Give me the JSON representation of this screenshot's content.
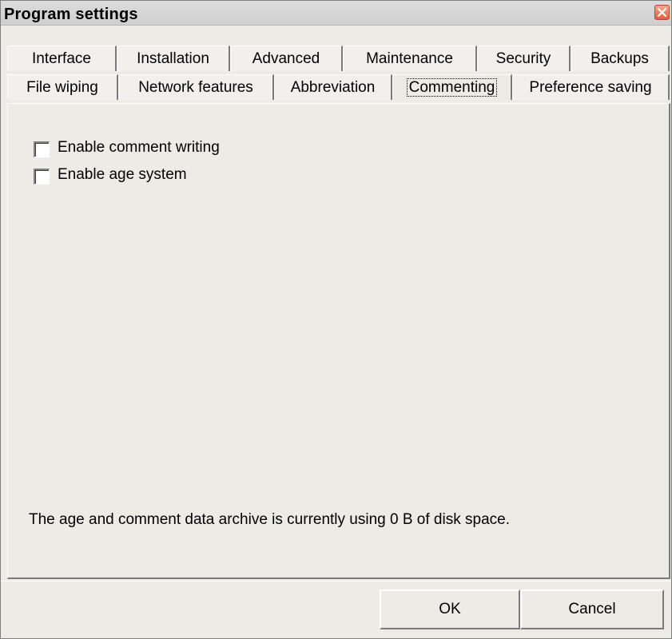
{
  "window": {
    "title": "Program settings"
  },
  "tabs": {
    "row1": [
      "Interface",
      "Installation",
      "Advanced",
      "Maintenance",
      "Security",
      "Backups"
    ],
    "row2": [
      "File wiping",
      "Network features",
      "Abbreviation",
      "Commenting",
      "Preference saving"
    ],
    "active": "Commenting"
  },
  "options": {
    "enable_comment_writing": {
      "label": "Enable comment writing",
      "checked": false
    },
    "enable_age_system": {
      "label": "Enable age system",
      "checked": false
    }
  },
  "info": {
    "text": "The age and comment data archive is currently using 0 B of disk space."
  },
  "buttons": {
    "ok": "OK",
    "cancel": "Cancel"
  },
  "colors": {
    "background": "#ecebe6",
    "close_button": "#e55b3b"
  }
}
